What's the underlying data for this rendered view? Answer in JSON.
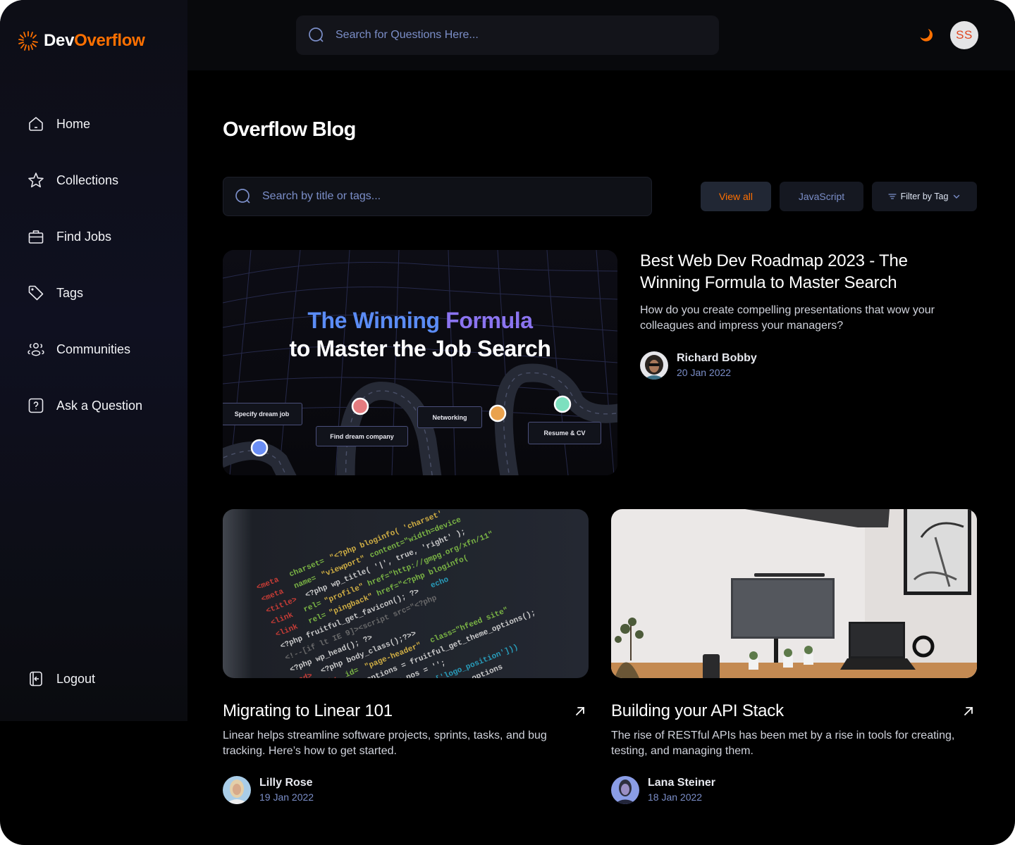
{
  "app": {
    "name_part1": "Dev",
    "name_part2": "Overflow",
    "brand_color": "#ff7000"
  },
  "header": {
    "search_placeholder": "Search for Questions Here...",
    "theme_icon": "moon-icon",
    "user_initials": "SS"
  },
  "sidebar": {
    "items": [
      {
        "label": "Home",
        "icon": "home-icon"
      },
      {
        "label": "Collections",
        "icon": "star-icon"
      },
      {
        "label": "Find Jobs",
        "icon": "briefcase-icon"
      },
      {
        "label": "Tags",
        "icon": "tag-icon"
      },
      {
        "label": "Communities",
        "icon": "users-icon"
      },
      {
        "label": "Ask a Question",
        "icon": "question-icon"
      }
    ],
    "logout_label": "Logout"
  },
  "main": {
    "title": "Overflow Blog",
    "search_placeholder": "Search by title or tags...",
    "filters": {
      "view_all": "View all",
      "javascript": "JavaScript",
      "filter_by_tag": "Filter by Tag"
    },
    "featured": {
      "image": {
        "headline_part1": "The Winning",
        "headline_part2": "Formula",
        "headline_line2": "to Master the Job Search",
        "steps": [
          "Specify dream job",
          "Find dream company",
          "Networking",
          "Resume & CV"
        ]
      },
      "title": "Best Web Dev Roadmap 2023 - The Winning Formula to Master Search",
      "description": "How do you create compelling presentations that wow your colleagues and impress your managers?",
      "author": "Richard Bobby",
      "date": "20 Jan 2022"
    },
    "posts": [
      {
        "title": "Migrating to Linear 101",
        "description": "Linear helps streamline software projects, sprints, tasks, and bug tracking. Here’s how to get started.",
        "author": "Lilly Rose",
        "date": "19 Jan 2022"
      },
      {
        "title": "Building your API Stack",
        "description": "The rise of RESTful APIs has been met by a rise in tools for creating, testing, and managing them.",
        "author": "Lana Steiner",
        "date": "18 Jan 2022"
      }
    ]
  }
}
